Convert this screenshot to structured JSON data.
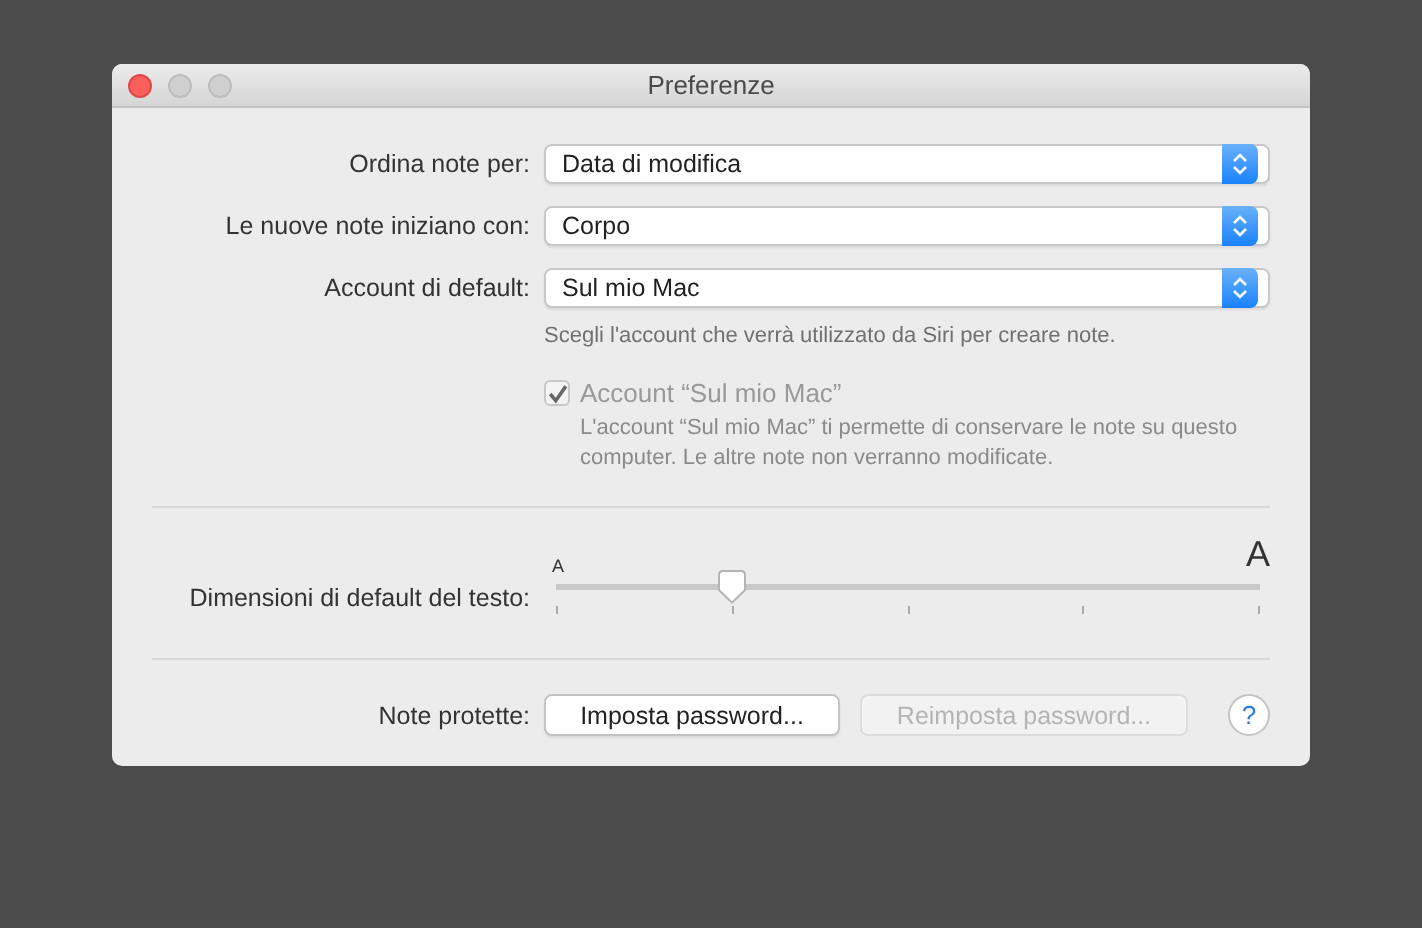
{
  "window": {
    "title": "Preferenze"
  },
  "popups": [
    {
      "label": "Ordina note per:",
      "value": "Data di modifica"
    },
    {
      "label": "Le nuove note iniziano con:",
      "value": "Corpo"
    },
    {
      "label": "Account di default:",
      "value": "Sul mio Mac"
    }
  ],
  "account_hint": "Scegli l'account che verrà utilizzato da Siri per creare note.",
  "local_account": {
    "label": "Account “Sul mio Mac”",
    "checked": true,
    "disabled": true,
    "description": "L'account “Sul mio Mac” ti permette di conservare le note su questo computer. Le altre note non verranno modificate."
  },
  "text_size": {
    "label": "Dimensioni di default del testo:",
    "small_label": "A",
    "large_label": "A",
    "level": 0.25
  },
  "protected_notes": {
    "label": "Note protette:",
    "buttons": [
      {
        "label": "Imposta password...",
        "disabled": false
      },
      {
        "label": "Reimposta password...",
        "disabled": true
      }
    ],
    "help": "?"
  }
}
